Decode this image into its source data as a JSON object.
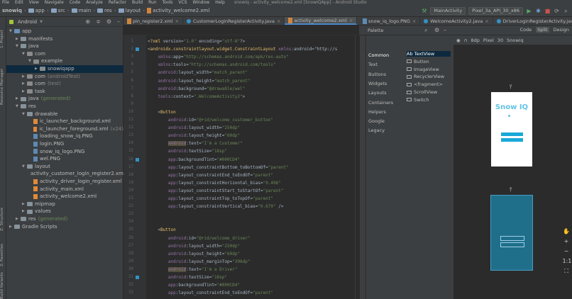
{
  "menu": {
    "items": [
      "File",
      "Edit",
      "View",
      "Navigate",
      "Code",
      "Analyze",
      "Refactor",
      "Build",
      "Run",
      "Tools",
      "VCS",
      "Window",
      "Help"
    ],
    "title": "snowiq - activity_welcome2.xml [SnowIQApp] - Android Studio"
  },
  "breadcrumb": [
    "snowiq",
    "app",
    "src",
    "main",
    "res",
    "layout",
    "activity_welcome2.xml"
  ],
  "toolbar": {
    "run_config": "MainActivity",
    "device": "Pixel_3a_API_30_x86"
  },
  "project": {
    "view_label": "Android",
    "tree": [
      {
        "label": "app",
        "indent": 0,
        "kind": "folder-blue",
        "arrow": "down"
      },
      {
        "label": "manifests",
        "indent": 1,
        "kind": "folder",
        "arrow": "right"
      },
      {
        "label": "java",
        "indent": 1,
        "kind": "folder",
        "arrow": "down"
      },
      {
        "label": "com",
        "indent": 2,
        "kind": "pkg",
        "arrow": "down"
      },
      {
        "label": "example",
        "indent": 3,
        "kind": "pkg",
        "arrow": "down"
      },
      {
        "label": "snowiqapp",
        "indent": 4,
        "kind": "pkg",
        "arrow": "right",
        "selected": true
      },
      {
        "label": "com",
        "suffix": "(androidTest)",
        "indent": 2,
        "kind": "pkg",
        "arrow": "right"
      },
      {
        "label": "com",
        "suffix": "(test)",
        "indent": 2,
        "kind": "pkg",
        "arrow": "right"
      },
      {
        "label": "task",
        "indent": 2,
        "kind": "pkg",
        "arrow": "right"
      },
      {
        "label": "java",
        "suffix": "(generated)",
        "indent": 1,
        "kind": "folder",
        "arrow": "right"
      },
      {
        "label": "res",
        "indent": 1,
        "kind": "folder",
        "arrow": "down"
      },
      {
        "label": "drawable",
        "indent": 2,
        "kind": "folder",
        "arrow": "down"
      },
      {
        "label": "ic_launcher_background.xml",
        "indent": 3,
        "kind": "xml"
      },
      {
        "label": "ic_launcher_foreground.xml",
        "suffix": "(v24)",
        "indent": 3,
        "kind": "xml"
      },
      {
        "label": "loading_snow_iq.PNG",
        "indent": 3,
        "kind": "png"
      },
      {
        "label": "login.PNG",
        "indent": 3,
        "kind": "png"
      },
      {
        "label": "snow_iq_logo.PNG",
        "indent": 3,
        "kind": "png"
      },
      {
        "label": "wel.PNG",
        "indent": 3,
        "kind": "png"
      },
      {
        "label": "layout",
        "indent": 2,
        "kind": "folder",
        "arrow": "down"
      },
      {
        "label": "activity_customer_login_register2.xml",
        "indent": 3,
        "kind": "xml"
      },
      {
        "label": "activity_driver_login_register.xml",
        "indent": 3,
        "kind": "xml"
      },
      {
        "label": "activity_main.xml",
        "indent": 3,
        "kind": "xml"
      },
      {
        "label": "activity_welcome2.xml",
        "indent": 3,
        "kind": "xml"
      },
      {
        "label": "mipmap",
        "indent": 2,
        "kind": "folder",
        "arrow": "right"
      },
      {
        "label": "values",
        "indent": 2,
        "kind": "folder",
        "arrow": "right"
      },
      {
        "label": "res",
        "suffix": "(generated)",
        "indent": 1,
        "kind": "folder",
        "arrow": "right"
      },
      {
        "label": "Gradle Scripts",
        "indent": 0,
        "kind": "folder",
        "arrow": "right"
      }
    ]
  },
  "side_labels": [
    "1: Project",
    "Resource Manager",
    "Z: Structure",
    "2: Favorites",
    "Build Variants"
  ],
  "tabs": [
    {
      "label": "pin_register2.xml"
    },
    {
      "label": "CustomerLoginRegisterActivity.java"
    },
    {
      "label": "activity_welcome2.xml",
      "active": true
    },
    {
      "label": "login.PNG"
    },
    {
      "label": "snow_iq_logo.PNG"
    },
    {
      "label": "WelcomeActivity2.java"
    },
    {
      "label": "DriverLoginRegisterActivity.java"
    }
  ],
  "view_modes": [
    "Code",
    "Split",
    "Design"
  ],
  "code": {
    "lines": [
      {
        "n": "1",
        "html": "<?xml version=\"1.0\" encoding=\"utf-8\"?>"
      },
      {
        "n": "2",
        "html": "<androidx.constraintlayout.widget.ConstraintLayout xmlns:android=\"http://s"
      },
      {
        "n": "3",
        "html": "    xmlns:app=\"http://schemas.android.com/apk/res-auto\""
      },
      {
        "n": "4",
        "html": "    xmlns:tools=\"http://schemas.android.com/tools\""
      },
      {
        "n": "5",
        "html": "    android:layout_width=\"match_parent\""
      },
      {
        "n": "6",
        "html": "    android:layout_height=\"match_parent\""
      },
      {
        "n": "7",
        "html": "    android:background=\"@drawable/wel\""
      },
      {
        "n": "8",
        "html": "    tools:context=\".WelcomeActivity2\">"
      },
      {
        "n": "9",
        "html": ""
      },
      {
        "n": "10",
        "html": "    <Button"
      },
      {
        "n": "11",
        "html": "        android:id=\"@+id/welcome_customer_button\""
      },
      {
        "n": "12",
        "html": "        android:layout_width=\"250dp\""
      },
      {
        "n": "13",
        "html": "        android:layout_height=\"60dp\""
      },
      {
        "n": "14",
        "html": "        android:text=\"I'm a Customer\"",
        "hl": true
      },
      {
        "n": "15",
        "html": "        android:textSize=\"18sp\""
      },
      {
        "n": "16",
        "html": "        app:backgroundTint=\"#000CD4\""
      },
      {
        "n": "17",
        "html": "        app:layout_constraintBottom_toBottomOf=\"parent\""
      },
      {
        "n": "18",
        "html": "        app:layout_constraintEnd_toEndOf=\"parent\""
      },
      {
        "n": "19",
        "html": "        app:layout_constraintHorizontal_bias=\"0.496\""
      },
      {
        "n": "20",
        "html": "        app:layout_constraintStart_toStartOf=\"parent\""
      },
      {
        "n": "21",
        "html": "        app:layout_constraintTop_toTopOf=\"parent\""
      },
      {
        "n": "22",
        "html": "        app:layout_constraintVertical_bias=\"0.679\" />"
      },
      {
        "n": "23",
        "html": ""
      },
      {
        "n": "24",
        "html": ""
      },
      {
        "n": "25",
        "html": "    <Button"
      },
      {
        "n": "26",
        "html": "        android:id=\"@+id/welcome_driver\""
      },
      {
        "n": "27",
        "html": "        android:layout_width=\"250dp\""
      },
      {
        "n": "28",
        "html": "        android:layout_height=\"60dp\""
      },
      {
        "n": "29",
        "html": "        android:layout_marginTop=\"396dp\""
      },
      {
        "n": "30",
        "html": "        android:text=\"I'm a Driver\"",
        "hl": true
      },
      {
        "n": "31",
        "html": "        android:textSize=\"18sp\""
      },
      {
        "n": "32",
        "html": "        app:backgroundTint=\"#000CD4\""
      },
      {
        "n": "33",
        "html": "        app:layout_constraintEnd_toEndOf=\"parent\""
      }
    ]
  },
  "palette": {
    "title": "Palette",
    "categories": [
      "Common",
      "Text",
      "Buttons",
      "Widgets",
      "Layouts",
      "Containers",
      "Helpers",
      "Google",
      "Legacy"
    ],
    "items": [
      "Ab TextView",
      "Button",
      "ImageView",
      "RecyclerView",
      "<fragment>",
      "ScrollView",
      "Switch"
    ]
  },
  "design": {
    "device": "Pixel",
    "api": "30",
    "theme": "Snowiq",
    "zoom": "8dp",
    "preview_title": "Snow IQ"
  }
}
